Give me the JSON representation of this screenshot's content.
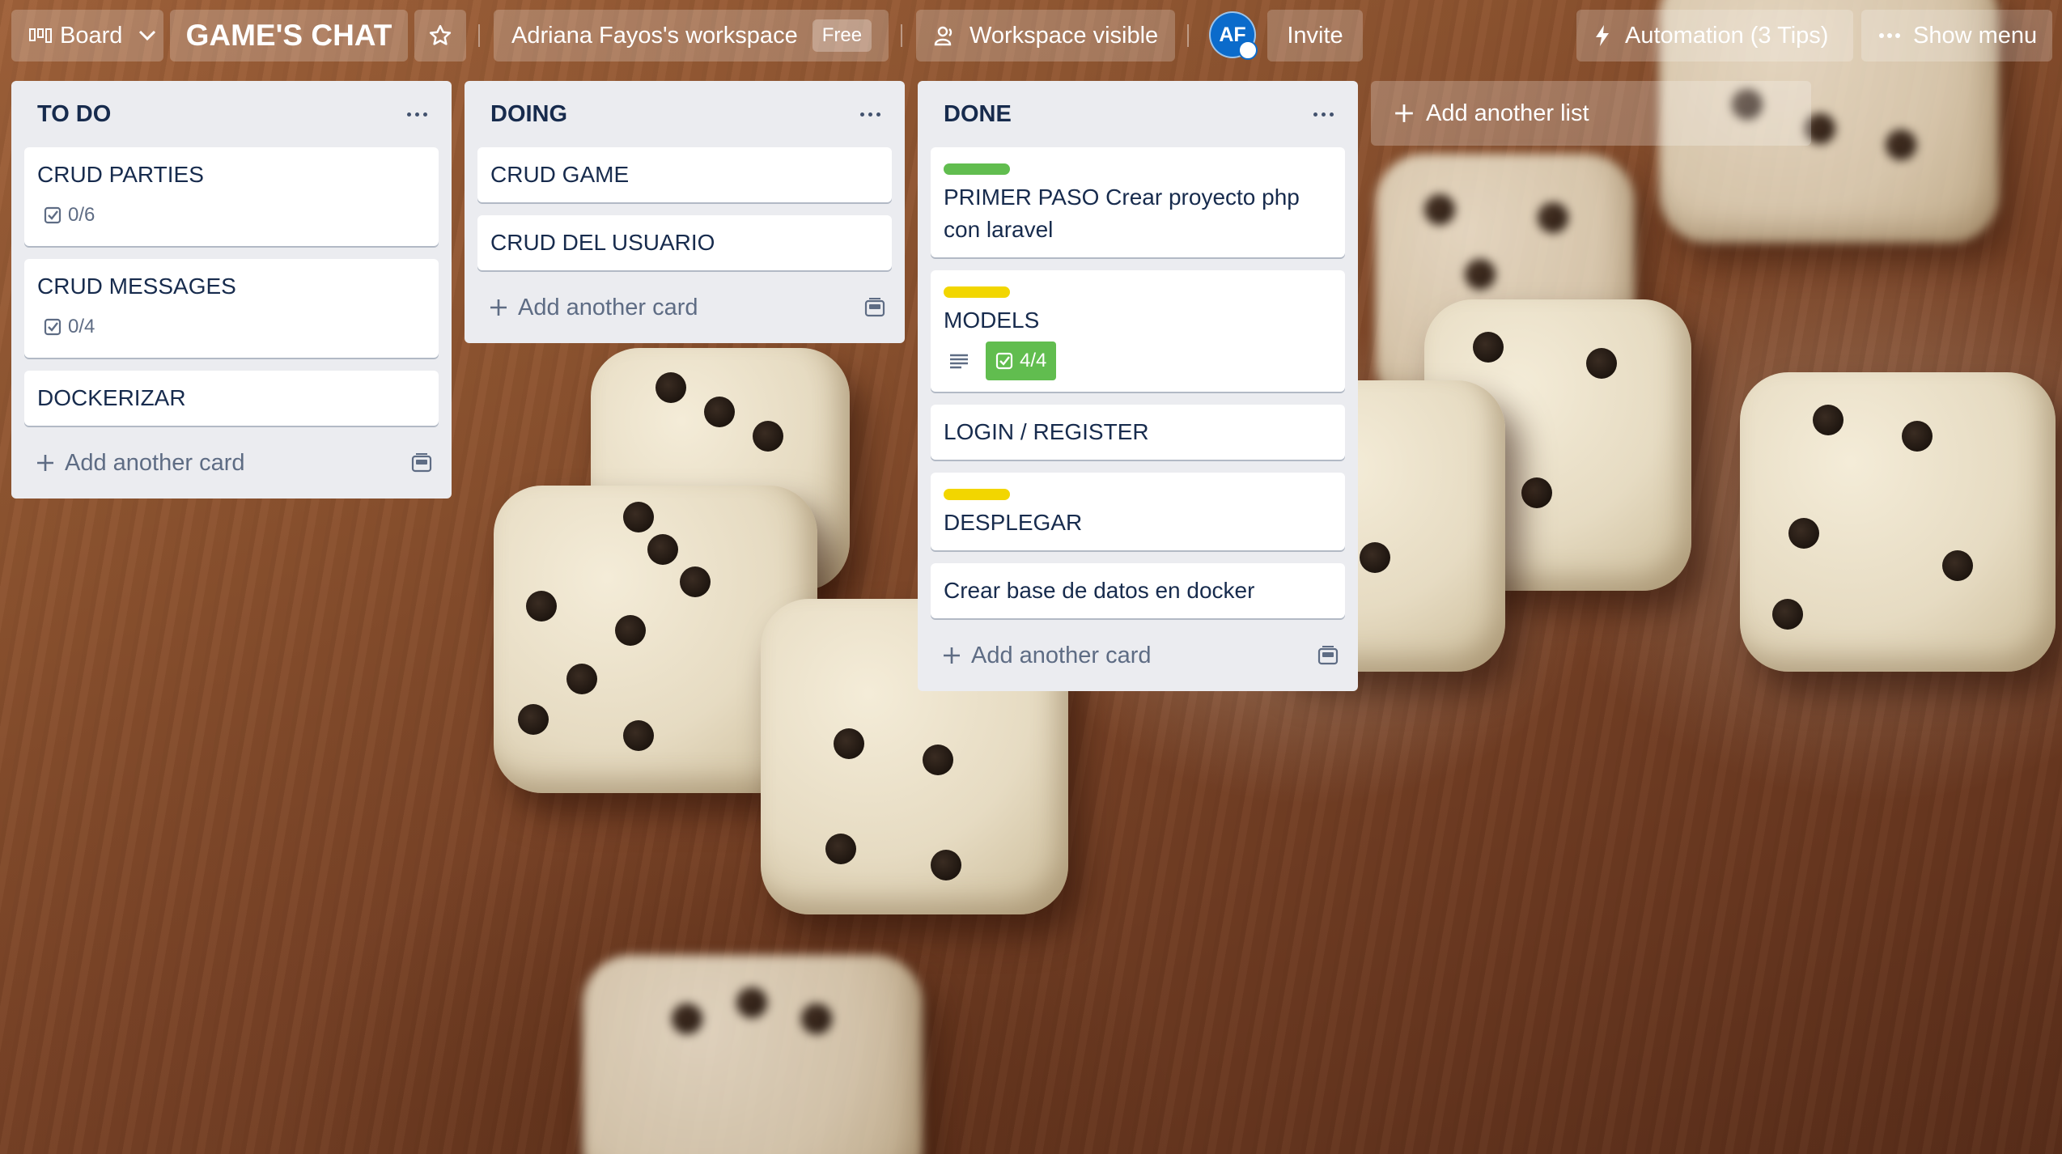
{
  "header": {
    "view_label": "Board",
    "board_title": "GAME'S CHAT",
    "workspace_name": "Adriana Fayos's workspace",
    "workspace_plan": "Free",
    "visibility_label": "Workspace visible",
    "avatar_initials": "AF",
    "invite_label": "Invite",
    "automation_label": "Automation (3 Tips)",
    "show_menu_label": "Show menu"
  },
  "lists": [
    {
      "title": "TO DO",
      "cards": [
        {
          "title": "CRUD PARTIES",
          "checklist": "0/6"
        },
        {
          "title": "CRUD MESSAGES",
          "checklist": "0/4"
        },
        {
          "title": "DOCKERIZAR"
        }
      ],
      "add_card_label": "Add another card"
    },
    {
      "title": "DOING",
      "cards": [
        {
          "title": "CRUD GAME"
        },
        {
          "title": "CRUD DEL USUARIO"
        }
      ],
      "add_card_label": "Add another card"
    },
    {
      "title": "DONE",
      "cards": [
        {
          "title": "PRIMER PASO Crear proyecto php con laravel",
          "label_color": "#61bd4f"
        },
        {
          "title": "MODELS",
          "label_color": "#f2d600",
          "checklist": "4/4",
          "has_description": true
        },
        {
          "title": "LOGIN / REGISTER"
        },
        {
          "title": "DESPLEGAR",
          "label_color": "#f2d600"
        },
        {
          "title": "Crear base de datos en docker"
        }
      ],
      "add_card_label": "Add another card"
    }
  ],
  "add_list_label": "Add another list",
  "colors": {
    "list_bg": "#ebecf0",
    "text": "#172b4d",
    "muted": "#5e6c84",
    "green_label": "#61bd4f",
    "yellow_label": "#f2d600",
    "avatar": "#0b6bcb"
  }
}
